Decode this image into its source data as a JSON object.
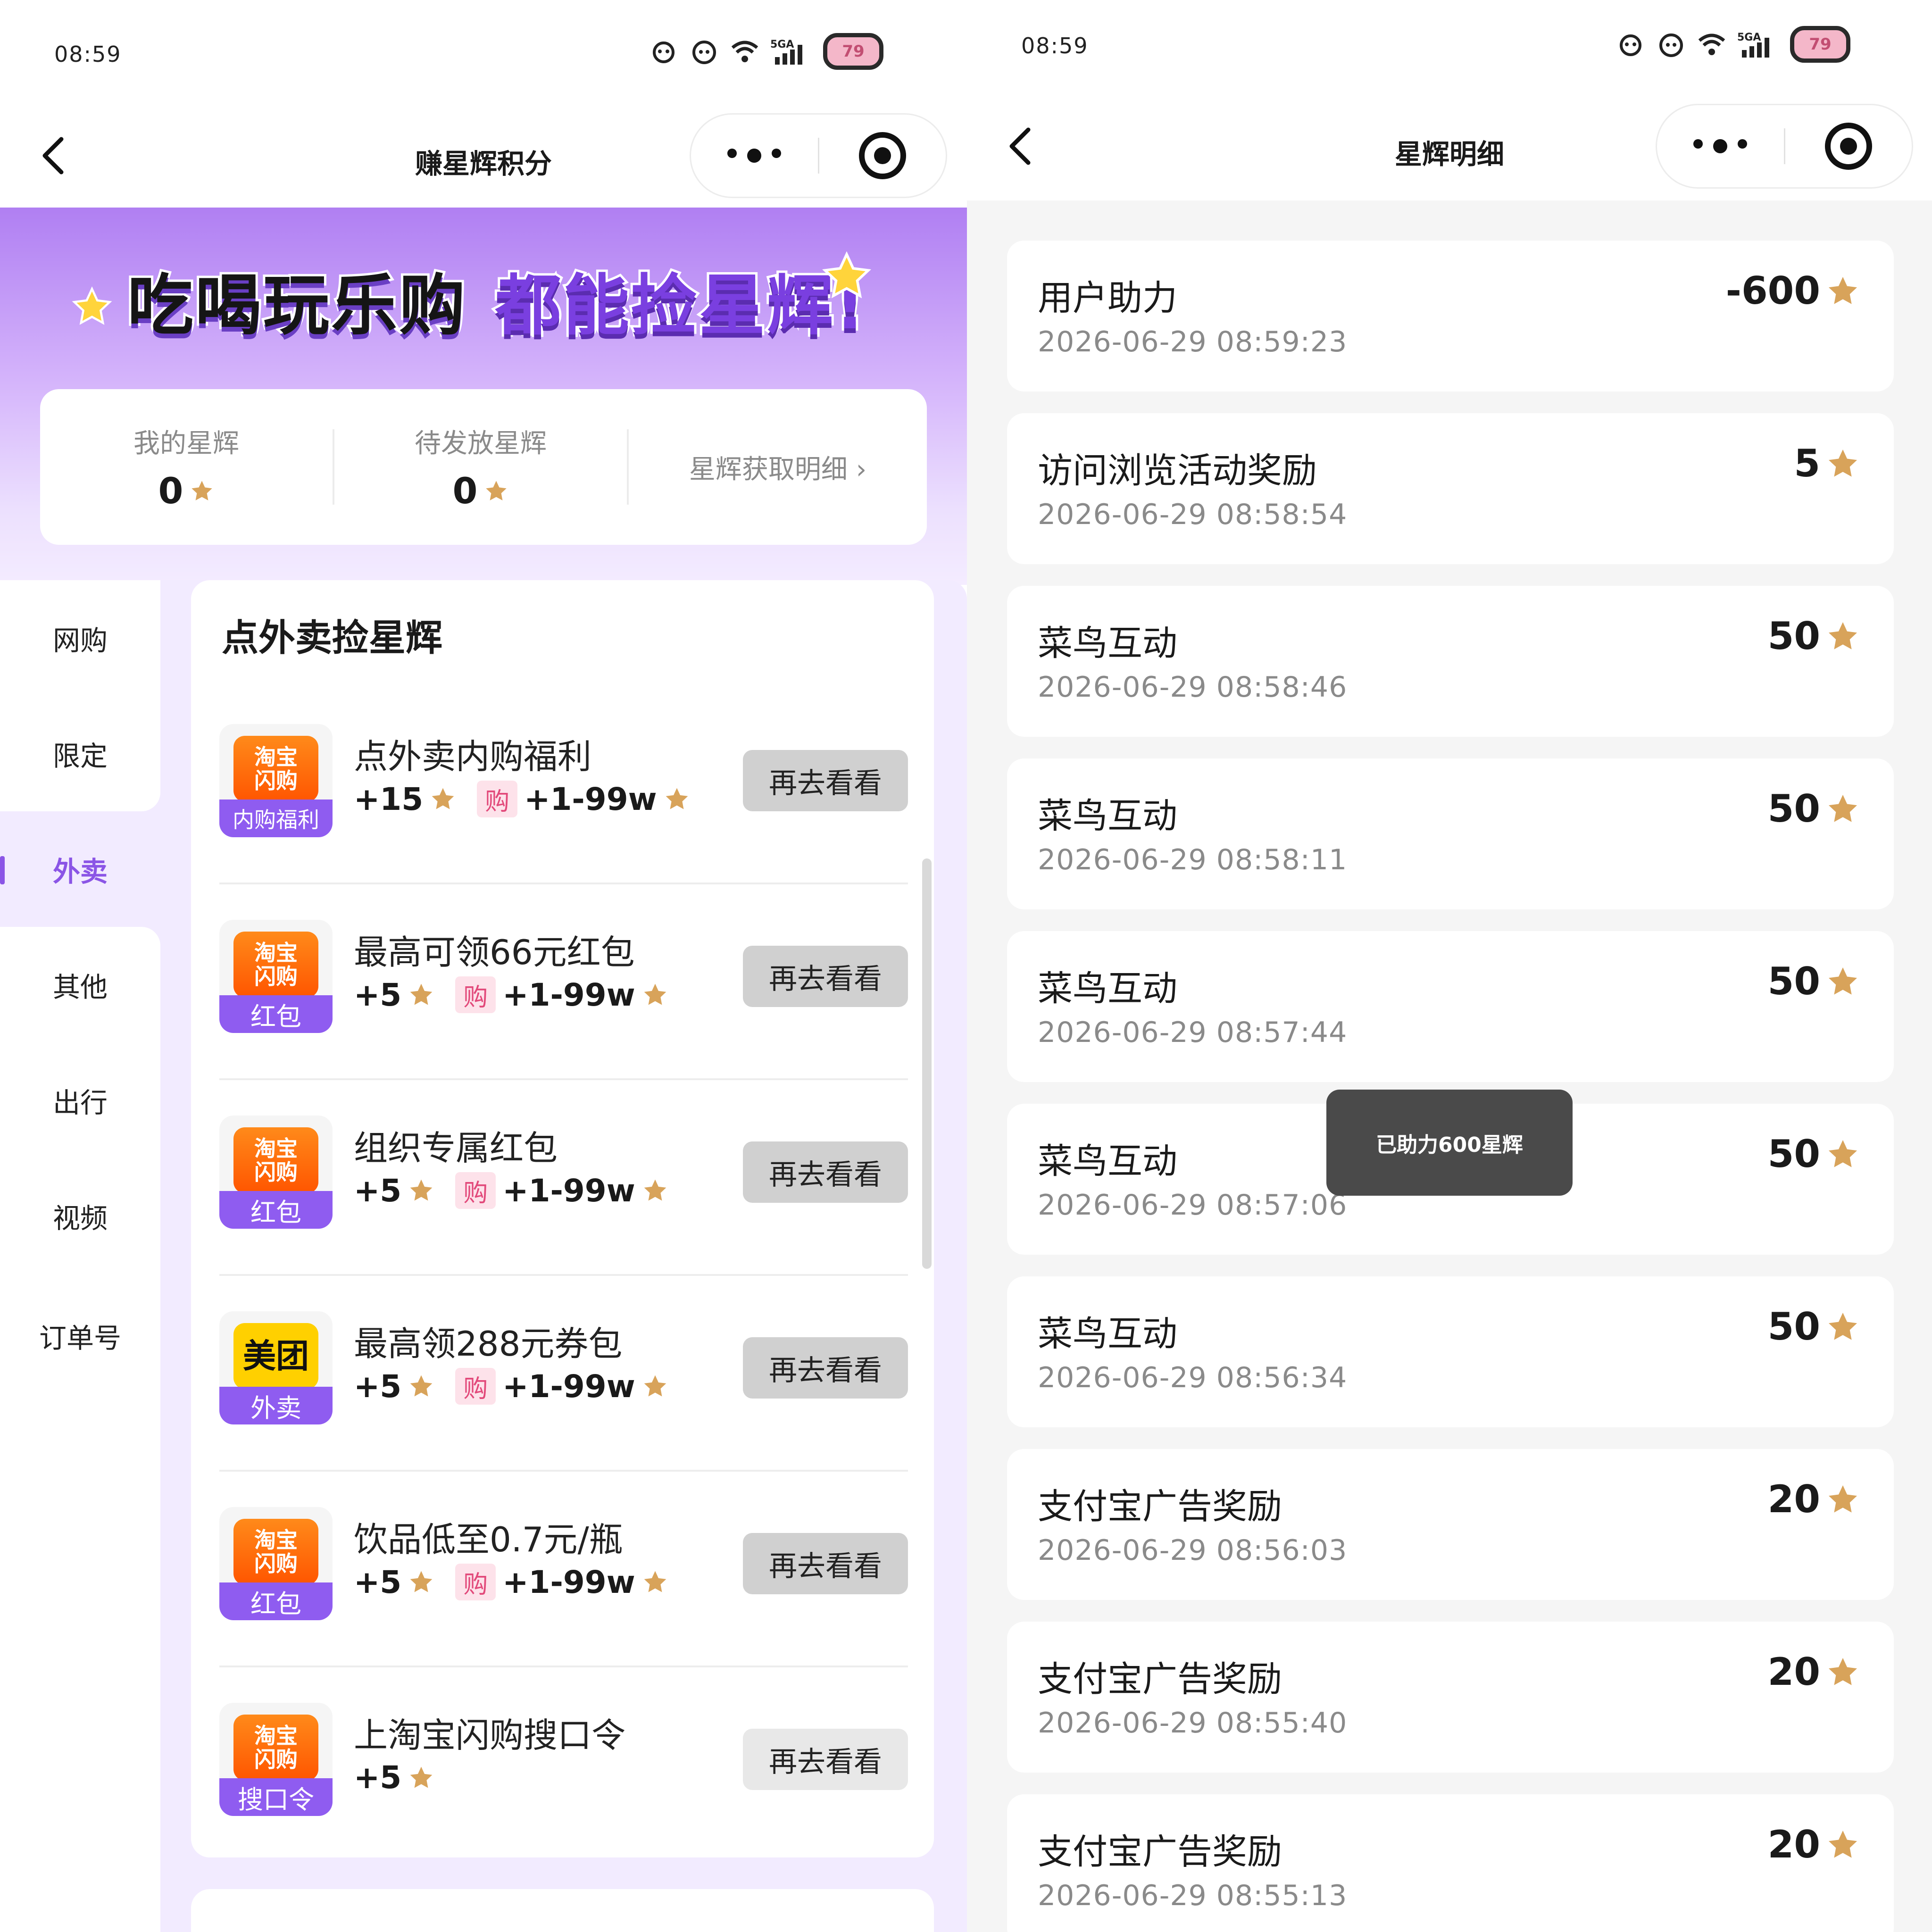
{
  "left": {
    "status": {
      "time": "08:59",
      "battery": "79"
    },
    "nav": {
      "title": "赚星辉积分"
    },
    "banner": {
      "slogan_black": "吃喝玩乐购",
      "slogan_purple": "都能捡星辉!"
    },
    "stats": {
      "my_label": "我的星辉",
      "my_value": "0",
      "pending_label": "待发放星辉",
      "pending_value": "0",
      "detail_link": "星辉获取明细 ›"
    },
    "sidebar": [
      {
        "label": "网购"
      },
      {
        "label": "限定"
      },
      {
        "label": "外卖"
      },
      {
        "label": "其他"
      },
      {
        "label": "出行"
      },
      {
        "label": "视频"
      },
      {
        "label": "订单号"
      }
    ],
    "section_title": "点外卖捡星辉",
    "tasks": [
      {
        "logo_top": "淘宝\n闪购",
        "logo_bar": "内购福利",
        "title": "点外卖内购福利",
        "reward": "+15",
        "buy_tag": "购",
        "buy_reward": "+1-99w",
        "button": "再去看看"
      },
      {
        "logo_top": "淘宝\n闪购",
        "logo_bar": "红包",
        "title": "最高可领66元红包",
        "reward": "+5",
        "buy_tag": "购",
        "buy_reward": "+1-99w",
        "button": "再去看看"
      },
      {
        "logo_top": "淘宝\n闪购",
        "logo_bar": "红包",
        "title": "组织专属红包",
        "reward": "+5",
        "buy_tag": "购",
        "buy_reward": "+1-99w",
        "button": "再去看看"
      },
      {
        "logo_top": "美团",
        "logo_bar": "外卖",
        "title": "最高领288元券包",
        "reward": "+5",
        "buy_tag": "购",
        "buy_reward": "+1-99w",
        "button": "再去看看"
      },
      {
        "logo_top": "淘宝\n闪购",
        "logo_bar": "红包",
        "title": "饮品低至0.7元/瓶",
        "reward": "+5",
        "buy_tag": "购",
        "buy_reward": "+1-99w",
        "button": "再去看看"
      },
      {
        "logo_top": "淘宝\n闪购",
        "logo_bar": "搜口令",
        "title": "上淘宝闪购搜口令",
        "reward": "+5",
        "button": "再去看看"
      }
    ]
  },
  "right": {
    "status": {
      "time": "08:59",
      "battery": "79"
    },
    "nav": {
      "title": "星辉明细"
    },
    "records": [
      {
        "name": "用户助力",
        "time": "2026-06-29 08:59:23",
        "amount": "-600"
      },
      {
        "name": "访问浏览活动奖励",
        "time": "2026-06-29 08:58:54",
        "amount": "5"
      },
      {
        "name": "菜鸟互动",
        "time": "2026-06-29 08:58:46",
        "amount": "50"
      },
      {
        "name": "菜鸟互动",
        "time": "2026-06-29 08:58:11",
        "amount": "50"
      },
      {
        "name": "菜鸟互动",
        "time": "2026-06-29 08:57:44",
        "amount": "50"
      },
      {
        "name": "菜鸟互动",
        "time": "2026-06-29 08:57:06",
        "amount": "50"
      },
      {
        "name": "菜鸟互动",
        "time": "2026-06-29 08:56:34",
        "amount": "50"
      },
      {
        "name": "支付宝广告奖励",
        "time": "2026-06-29 08:56:03",
        "amount": "20"
      },
      {
        "name": "支付宝广告奖励",
        "time": "2026-06-29 08:55:40",
        "amount": "20"
      },
      {
        "name": "支付宝广告奖励",
        "time": "2026-06-29 08:55:13",
        "amount": "20"
      }
    ],
    "toast": "已助力600星辉"
  },
  "colors": {
    "accent": "#8b55e6",
    "star": "#d8a35a",
    "button": "#d0d0d0",
    "toast": "#4a4a4a"
  },
  "icons": [
    "back-arrow-icon",
    "more-dots-icon",
    "record-target-icon",
    "star-icon",
    "wifi-icon",
    "signal-icon",
    "battery-icon"
  ]
}
